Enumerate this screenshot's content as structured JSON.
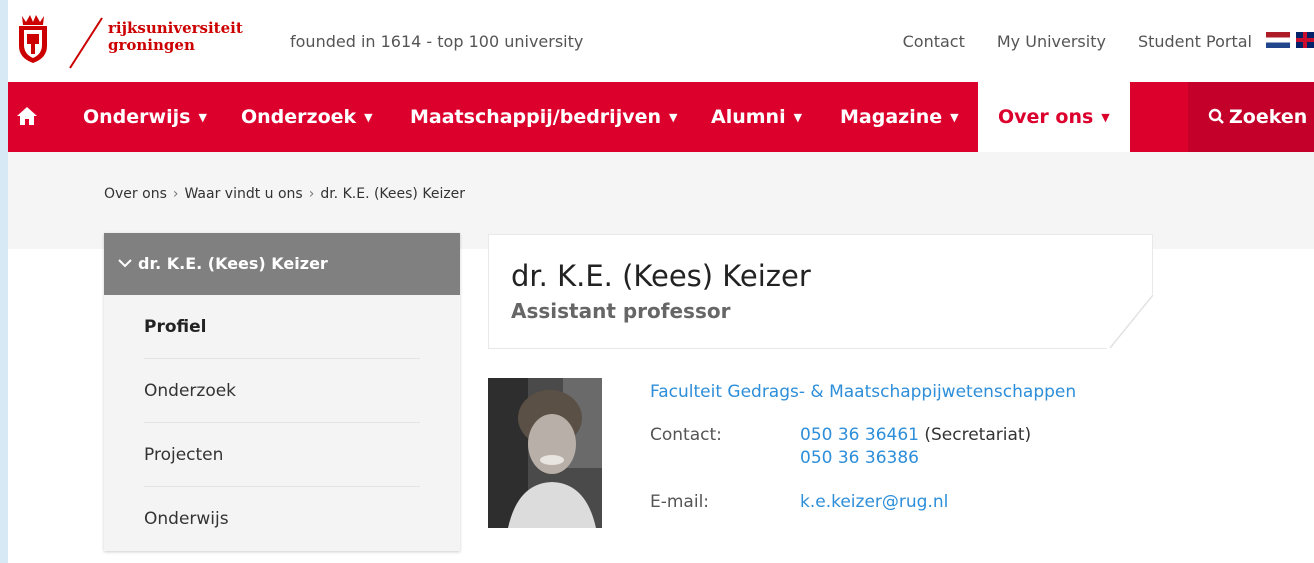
{
  "header": {
    "logo_line1": "rijksuniversiteit",
    "logo_line2": "groningen",
    "tagline": "founded in 1614  -  top 100 university",
    "links": [
      "Contact",
      "My University",
      "Student Portal"
    ]
  },
  "nav": {
    "items": [
      {
        "label": "Onderwijs"
      },
      {
        "label": "Onderzoek"
      },
      {
        "label": "Maatschappij/bedrijven"
      },
      {
        "label": "Alumni"
      },
      {
        "label": "Magazine"
      },
      {
        "label": "Over ons"
      }
    ],
    "search_label": "Zoeken"
  },
  "breadcrumb": [
    "Over ons",
    "Waar vindt u ons",
    "dr. K.E. (Kees) Keizer"
  ],
  "sidebar": {
    "heading": "dr. K.E. (Kees) Keizer",
    "items": [
      "Profiel",
      "Onderzoek",
      "Projecten",
      "Onderwijs"
    ]
  },
  "profile": {
    "name": "dr. K.E. (Kees) Keizer",
    "role": "Assistant professor",
    "faculty": "Faculteit Gedrags- & Maatschappijwetenschappen",
    "contact_label": "Contact:",
    "phone1": "050 36 36461",
    "phone1_note": " (Secretariat)",
    "phone2": "050 36 36386",
    "email_label": "E-mail:",
    "email": "k.e.keizer@rug.nl"
  },
  "colors": {
    "brand_red": "#dc002d",
    "link_blue": "#2d8ed9"
  },
  "icons": [
    "crest-logo-icon",
    "home-icon",
    "search-icon",
    "chevron-down-icon",
    "flag-nl-icon",
    "flag-uk-icon"
  ]
}
